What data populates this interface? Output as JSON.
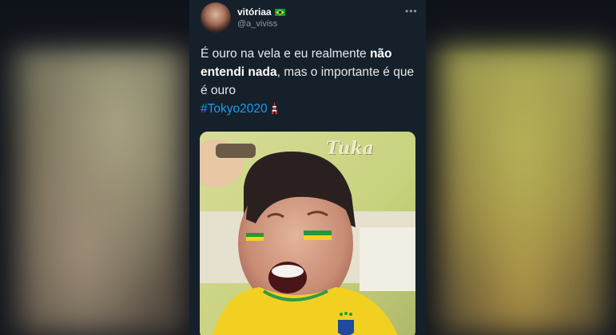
{
  "tweet": {
    "display_name": "vitóriaa",
    "name_flag_icon": "brazil-flag-icon",
    "handle": "@a_viviss",
    "more_icon": "more-icon",
    "text": {
      "part1": "É ouro na vela e eu realmente ",
      "bold": "não entendi nada",
      "part2": ", mas o importante é que é ouro",
      "hashtag": "#Tokyo2020",
      "hashtag_emoji_icon": "tokyo-tower-icon"
    },
    "media": {
      "watermark": "Tuka"
    }
  },
  "colors": {
    "tweet_bg": "#15202b",
    "hashtag": "#1d9bf0",
    "secondary_text": "#8b98a5"
  }
}
